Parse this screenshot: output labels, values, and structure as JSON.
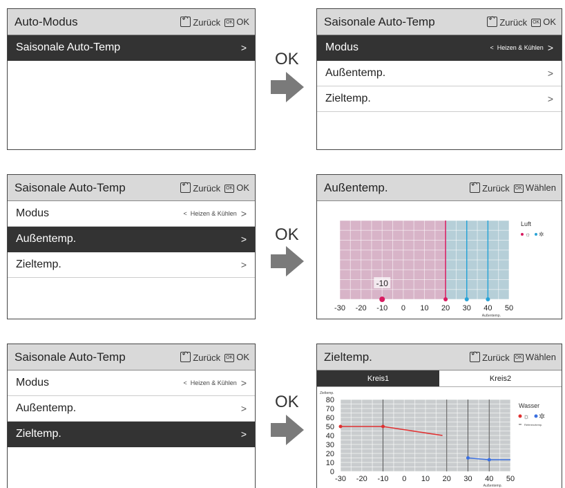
{
  "common": {
    "back_label": "Zurück",
    "ok_label": "OK",
    "select_label": "Wählen",
    "ok_arrow_text": "OK"
  },
  "screens": {
    "s1": {
      "title": "Auto-Modus",
      "rows": [
        {
          "label": "Saisonale Auto-Temp",
          "chevron": ">"
        }
      ]
    },
    "s2": {
      "title": "Saisonale Auto-Temp",
      "rows": [
        {
          "label": "Modus",
          "value": "Heizen & Kühlen",
          "left_chevron": "<",
          "chevron": ">"
        },
        {
          "label": "Außentemp.",
          "chevron": ">"
        },
        {
          "label": "Zieltemp.",
          "chevron": ">"
        }
      ]
    },
    "s3": {
      "title": "Saisonale Auto-Temp",
      "rows": [
        {
          "label": "Modus",
          "value": "Heizen & Kühlen",
          "left_chevron": "<",
          "chevron": ">"
        },
        {
          "label": "Außentemp.",
          "chevron": ">"
        },
        {
          "label": "Zieltemp.",
          "chevron": ">"
        }
      ]
    },
    "s4": {
      "title": "Außentemp.",
      "legend_title": "Luft",
      "marker_label": "-10",
      "axis_label": "Außentemp."
    },
    "s5": {
      "title": "Saisonale Auto-Temp",
      "rows": [
        {
          "label": "Modus",
          "value": "Heizen & Kühlen",
          "left_chevron": "<",
          "chevron": ">"
        },
        {
          "label": "Außentemp.",
          "chevron": ">"
        },
        {
          "label": "Zieltemp.",
          "chevron": ">"
        }
      ]
    },
    "s6": {
      "title": "Zieltemp.",
      "tabs": [
        "Kreis1",
        "Kreis2"
      ],
      "y_axis_label": "Zieltemp.",
      "legend_title": "Wasser",
      "legend_sub": "Referenztemp.",
      "axis_label": "Außentemp."
    }
  },
  "chart_data": [
    {
      "type": "line",
      "name": "Außentemp.",
      "xticks": [
        -30,
        -20,
        -10,
        0,
        10,
        20,
        30,
        40,
        50
      ],
      "heat_marker": -10,
      "heat_limit": 20,
      "cool_markers": [
        30,
        40
      ],
      "colors": {
        "heat_zone": "#d8b4c8",
        "cool_zone": "#b6cfd8",
        "heat": "#d81b60",
        "cool": "#29a3d6"
      }
    },
    {
      "type": "line",
      "name": "Zieltemp.",
      "xticks": [
        -30,
        -20,
        -10,
        0,
        10,
        20,
        30,
        40,
        50
      ],
      "yticks": [
        0,
        10,
        20,
        30,
        40,
        50,
        60,
        70,
        80
      ],
      "series": [
        {
          "name": "heat",
          "points": [
            [
              -30,
              50
            ],
            [
              -10,
              50
            ],
            [
              18,
              40
            ]
          ],
          "color": "#e03030"
        },
        {
          "name": "cool",
          "points": [
            [
              30,
              15
            ],
            [
              40,
              13
            ],
            [
              50,
              13
            ]
          ],
          "color": "#3a6fe0"
        }
      ]
    }
  ]
}
